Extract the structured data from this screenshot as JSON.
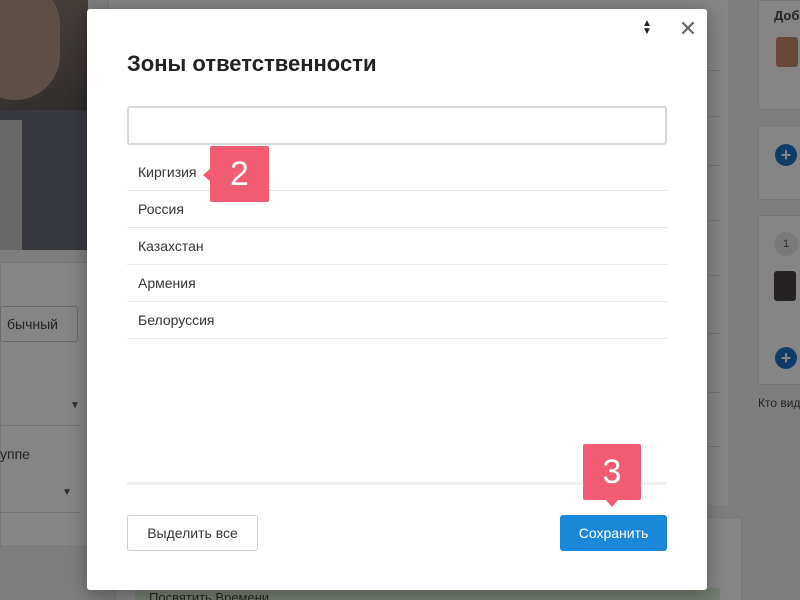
{
  "background": {
    "type_button_label": "бычный",
    "group_label": "уппе",
    "right_header": "Доб",
    "right_counter": "1",
    "right_footer_text": "Кто вид",
    "bottom_strip_text": "Посвятить Времени"
  },
  "modal": {
    "title": "Зоны ответственности",
    "search": {
      "value": "",
      "placeholder": ""
    },
    "items": [
      {
        "label": "Киргизия"
      },
      {
        "label": "Россия"
      },
      {
        "label": "Казахстан"
      },
      {
        "label": "Армения"
      },
      {
        "label": "Белоруссия"
      }
    ],
    "select_all_label": "Выделить все",
    "save_label": "Сохранить",
    "close_glyph": "✕"
  },
  "callouts": {
    "step_2": "2",
    "step_3": "3"
  },
  "colors": {
    "primary": "#1b87d9",
    "callout": "#f25c72",
    "plus": "#1a73c9"
  }
}
